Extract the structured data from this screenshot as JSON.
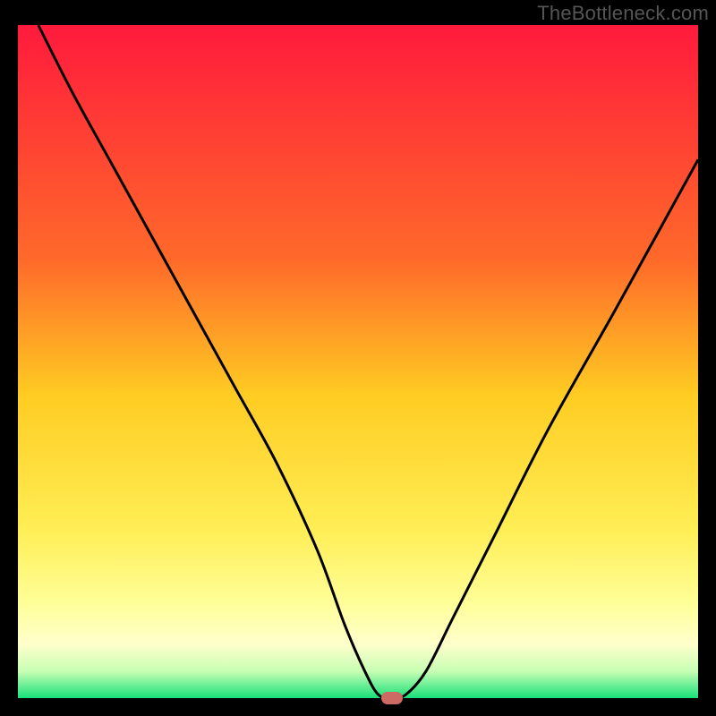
{
  "watermark": "TheBottleneck.com",
  "chart_data": {
    "type": "line",
    "title": "",
    "xlabel": "",
    "ylabel": "",
    "xlim": [
      0,
      100
    ],
    "ylim": [
      0,
      100
    ],
    "gradient_stops": [
      {
        "offset": 0,
        "color": "#ff1a3c"
      },
      {
        "offset": 35,
        "color": "#ff6a2a"
      },
      {
        "offset": 55,
        "color": "#ffcc22"
      },
      {
        "offset": 75,
        "color": "#ffee55"
      },
      {
        "offset": 86,
        "color": "#ffff99"
      },
      {
        "offset": 92,
        "color": "#ffffcc"
      },
      {
        "offset": 96,
        "color": "#c8ffb4"
      },
      {
        "offset": 100,
        "color": "#18e07a"
      }
    ],
    "series": [
      {
        "name": "bottleneck-curve",
        "color": "#000000",
        "width": 3,
        "x": [
          3,
          8,
          14,
          20,
          26,
          32,
          38,
          44,
          48,
          51,
          53,
          55,
          57,
          60,
          64,
          70,
          78,
          88,
          100
        ],
        "y": [
          100,
          90,
          79,
          68,
          57,
          46,
          35,
          22,
          11,
          4,
          0.5,
          0,
          0.5,
          4,
          12,
          24,
          40,
          58,
          80
        ]
      }
    ],
    "marker": {
      "x": 55,
      "y": 0,
      "color": "#cc6a63"
    }
  }
}
